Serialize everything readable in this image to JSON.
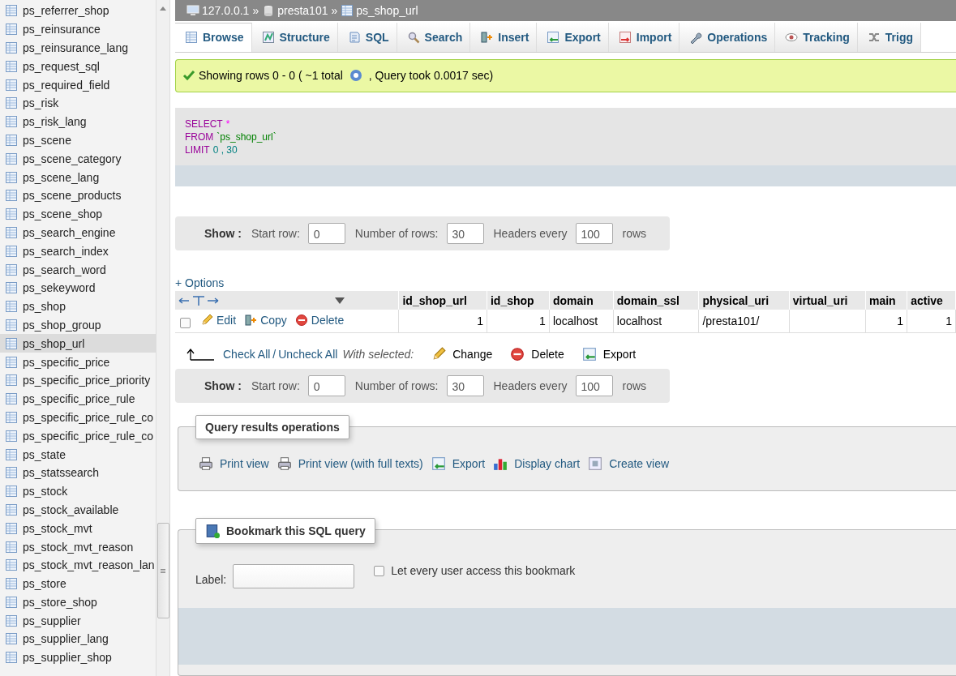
{
  "sidebar": {
    "items": [
      {
        "name": "ps_referrer_shop",
        "selected": false
      },
      {
        "name": "ps_reinsurance",
        "selected": false
      },
      {
        "name": "ps_reinsurance_lang",
        "selected": false
      },
      {
        "name": "ps_request_sql",
        "selected": false
      },
      {
        "name": "ps_required_field",
        "selected": false
      },
      {
        "name": "ps_risk",
        "selected": false
      },
      {
        "name": "ps_risk_lang",
        "selected": false
      },
      {
        "name": "ps_scene",
        "selected": false
      },
      {
        "name": "ps_scene_category",
        "selected": false
      },
      {
        "name": "ps_scene_lang",
        "selected": false
      },
      {
        "name": "ps_scene_products",
        "selected": false
      },
      {
        "name": "ps_scene_shop",
        "selected": false
      },
      {
        "name": "ps_search_engine",
        "selected": false
      },
      {
        "name": "ps_search_index",
        "selected": false
      },
      {
        "name": "ps_search_word",
        "selected": false
      },
      {
        "name": "ps_sekeyword",
        "selected": false
      },
      {
        "name": "ps_shop",
        "selected": false
      },
      {
        "name": "ps_shop_group",
        "selected": false
      },
      {
        "name": "ps_shop_url",
        "selected": true
      },
      {
        "name": "ps_specific_price",
        "selected": false
      },
      {
        "name": "ps_specific_price_priority",
        "selected": false
      },
      {
        "name": "ps_specific_price_rule",
        "selected": false
      },
      {
        "name": "ps_specific_price_rule_co",
        "selected": false
      },
      {
        "name": "ps_specific_price_rule_co",
        "selected": false
      },
      {
        "name": "ps_state",
        "selected": false
      },
      {
        "name": "ps_statssearch",
        "selected": false
      },
      {
        "name": "ps_stock",
        "selected": false
      },
      {
        "name": "ps_stock_available",
        "selected": false
      },
      {
        "name": "ps_stock_mvt",
        "selected": false
      },
      {
        "name": "ps_stock_mvt_reason",
        "selected": false
      },
      {
        "name": "ps_stock_mvt_reason_lan",
        "selected": false
      },
      {
        "name": "ps_store",
        "selected": false
      },
      {
        "name": "ps_store_shop",
        "selected": false
      },
      {
        "name": "ps_supplier",
        "selected": false
      },
      {
        "name": "ps_supplier_lang",
        "selected": false
      },
      {
        "name": "ps_supplier_shop",
        "selected": false
      }
    ]
  },
  "breadcrumb": {
    "separator": "»",
    "items": [
      {
        "label": "127.0.0.1",
        "kind": "server"
      },
      {
        "label": "presta101",
        "kind": "database"
      },
      {
        "label": "ps_shop_url",
        "kind": "table"
      }
    ]
  },
  "tabs": [
    {
      "label": "Browse",
      "kind": "browse",
      "selected": true
    },
    {
      "label": "Structure",
      "kind": "structure",
      "selected": false
    },
    {
      "label": "SQL",
      "kind": "sql",
      "selected": false
    },
    {
      "label": "Search",
      "kind": "search",
      "selected": false
    },
    {
      "label": "Insert",
      "kind": "insert",
      "selected": false
    },
    {
      "label": "Export",
      "kind": "export",
      "selected": false
    },
    {
      "label": "Import",
      "kind": "import",
      "selected": false
    },
    {
      "label": "Operations",
      "kind": "operations",
      "selected": false
    },
    {
      "label": "Tracking",
      "kind": "tracking",
      "selected": false
    },
    {
      "label": "Trigg",
      "kind": "triggers",
      "selected": false
    }
  ],
  "message": {
    "text": "Showing rows 0 - 0 ( ~1 total",
    "after": ", Query took 0.0017 sec)"
  },
  "sql": {
    "lines": [
      [
        {
          "text": "SELECT",
          "kind": "keyword"
        },
        {
          "text": "*",
          "kind": "operator"
        }
      ],
      [
        {
          "text": "FROM",
          "kind": "keyword"
        },
        {
          "text": "`ps_shop_url`",
          "kind": "name"
        }
      ],
      [
        {
          "text": "LIMIT",
          "kind": "keyword"
        },
        {
          "text": "0 , 30",
          "kind": "number"
        }
      ]
    ]
  },
  "navigation": [
    {
      "show": "Show :",
      "start_label": "Start row:",
      "start": "0",
      "rows_label": "Number of rows:",
      "rows": "30",
      "headers_label": "Headers every",
      "headers": "100",
      "unit": "rows"
    },
    {
      "show": "Show :",
      "start_label": "Start row:",
      "start": "0",
      "rows_label": "Number of rows:",
      "rows": "30",
      "headers_label": "Headers every",
      "headers": "100",
      "unit": "rows"
    }
  ],
  "options": "+ Options",
  "table": {
    "columns": [
      "id_shop_url",
      "id_shop",
      "domain",
      "domain_ssl",
      "physical_uri",
      "virtual_uri",
      "main",
      "active"
    ],
    "rows": [
      {
        "checked": false,
        "actions": [
          {
            "label": "Edit",
            "kind": "edit"
          },
          {
            "label": "Copy",
            "kind": "copy"
          },
          {
            "label": "Delete",
            "kind": "delete"
          }
        ],
        "cells": [
          "1",
          "1",
          "localhost",
          "localhost",
          "/presta101/",
          null,
          "1",
          "1"
        ]
      }
    ]
  },
  "bulk": {
    "check_all": "Check All",
    "slash": "/",
    "uncheck_all": "Uncheck All",
    "with_selected": "With selected:",
    "actions": [
      {
        "label": "Change",
        "kind": "edit"
      },
      {
        "label": "Delete",
        "kind": "delete"
      },
      {
        "label": "Export",
        "kind": "export"
      }
    ]
  },
  "query_ops": {
    "legend": "Query results operations",
    "links": [
      {
        "label": "Print view",
        "kind": "print"
      },
      {
        "label": "Print view (with full texts)",
        "kind": "print"
      },
      {
        "label": "Export",
        "kind": "export"
      },
      {
        "label": "Display chart",
        "kind": "chart"
      },
      {
        "label": "Create view",
        "kind": "view"
      }
    ]
  },
  "bookmark": {
    "legend": "Bookmark this SQL query",
    "label": "Label:",
    "shared_label": "Let every user access this bookmark",
    "shared": false
  }
}
